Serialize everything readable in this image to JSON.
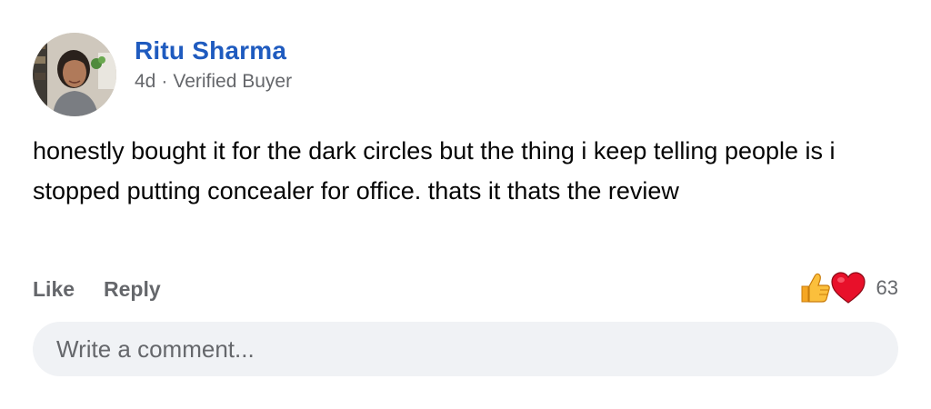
{
  "comment": {
    "author": {
      "name": "Ritu Sharma",
      "avatar_icon": "profile-photo"
    },
    "meta": {
      "time": "4d",
      "separator": "·",
      "badge": "Verified Buyer"
    },
    "text": "honestly bought it for the dark circles but the thing i keep telling people is i stopped putting concealer for office. thats it thats the review",
    "actions": {
      "like_label": "Like",
      "reply_label": "Reply"
    },
    "reactions": {
      "icons": [
        "thumbs-up-icon",
        "heart-icon"
      ],
      "count": "63"
    },
    "input": {
      "placeholder": "Write a comment..."
    }
  },
  "colors": {
    "name": "#1f5bbf",
    "secondary_text": "#65676b",
    "input_background": "#f0f2f5",
    "like_blue": "#1877f2",
    "heart_red": "#f33e58"
  }
}
